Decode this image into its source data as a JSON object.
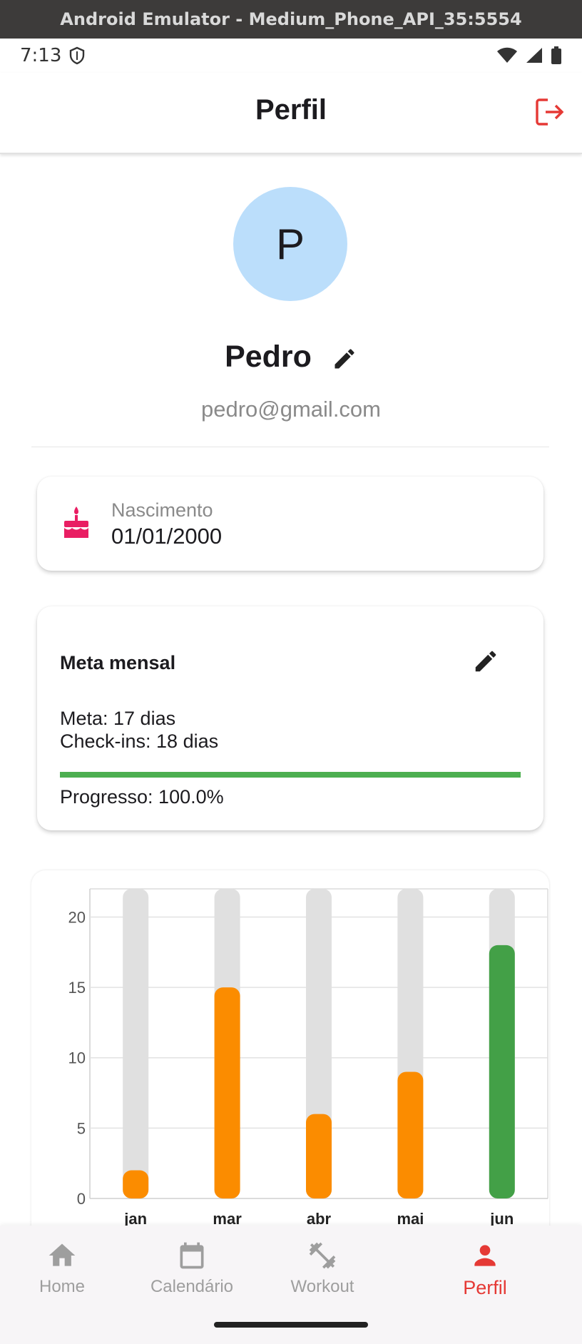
{
  "window": {
    "title": "Android Emulator - Medium_Phone_API_35:5554"
  },
  "status_bar": {
    "time": "7:13"
  },
  "app_bar": {
    "title": "Perfil",
    "logout_icon": "logout-icon"
  },
  "profile": {
    "avatar_initial": "P",
    "name": "Pedro",
    "email": "pedro@gmail.com"
  },
  "birth": {
    "label": "Nascimento",
    "value": "01/01/2000",
    "icon": "cake-icon"
  },
  "meta": {
    "title": "Meta mensal",
    "meta_text": "Meta: 17 dias",
    "checkins_text": "Check-ins: 18 dias",
    "progress_text": "Progresso: 100.0%",
    "progress_value": 1.0
  },
  "colors": {
    "accent": "#e53935",
    "avatar_bg": "#bbdefb",
    "bar_below_goal": "#fb8c00",
    "bar_goal_reached": "#43a047",
    "bar_track": "#e0e0e0",
    "progress": "#4caf50"
  },
  "chart_data": {
    "type": "bar",
    "categories": [
      "jan",
      "mar",
      "abr",
      "mai",
      "jun"
    ],
    "values": [
      2,
      15,
      6,
      9,
      18
    ],
    "goal_reached": [
      false,
      false,
      false,
      false,
      true
    ],
    "background_max": 22,
    "ylim": [
      0,
      22
    ],
    "yticks": [
      0,
      5,
      10,
      15,
      20
    ],
    "grid": true
  },
  "bottom_nav": {
    "items": [
      {
        "label": "Home",
        "icon": "home-icon",
        "active": false
      },
      {
        "label": "Calendário",
        "icon": "calendar-icon",
        "active": false
      },
      {
        "label": "Workout",
        "icon": "dumbbell-icon",
        "active": false
      },
      {
        "label": "Perfil",
        "icon": "person-icon",
        "active": true
      }
    ]
  }
}
